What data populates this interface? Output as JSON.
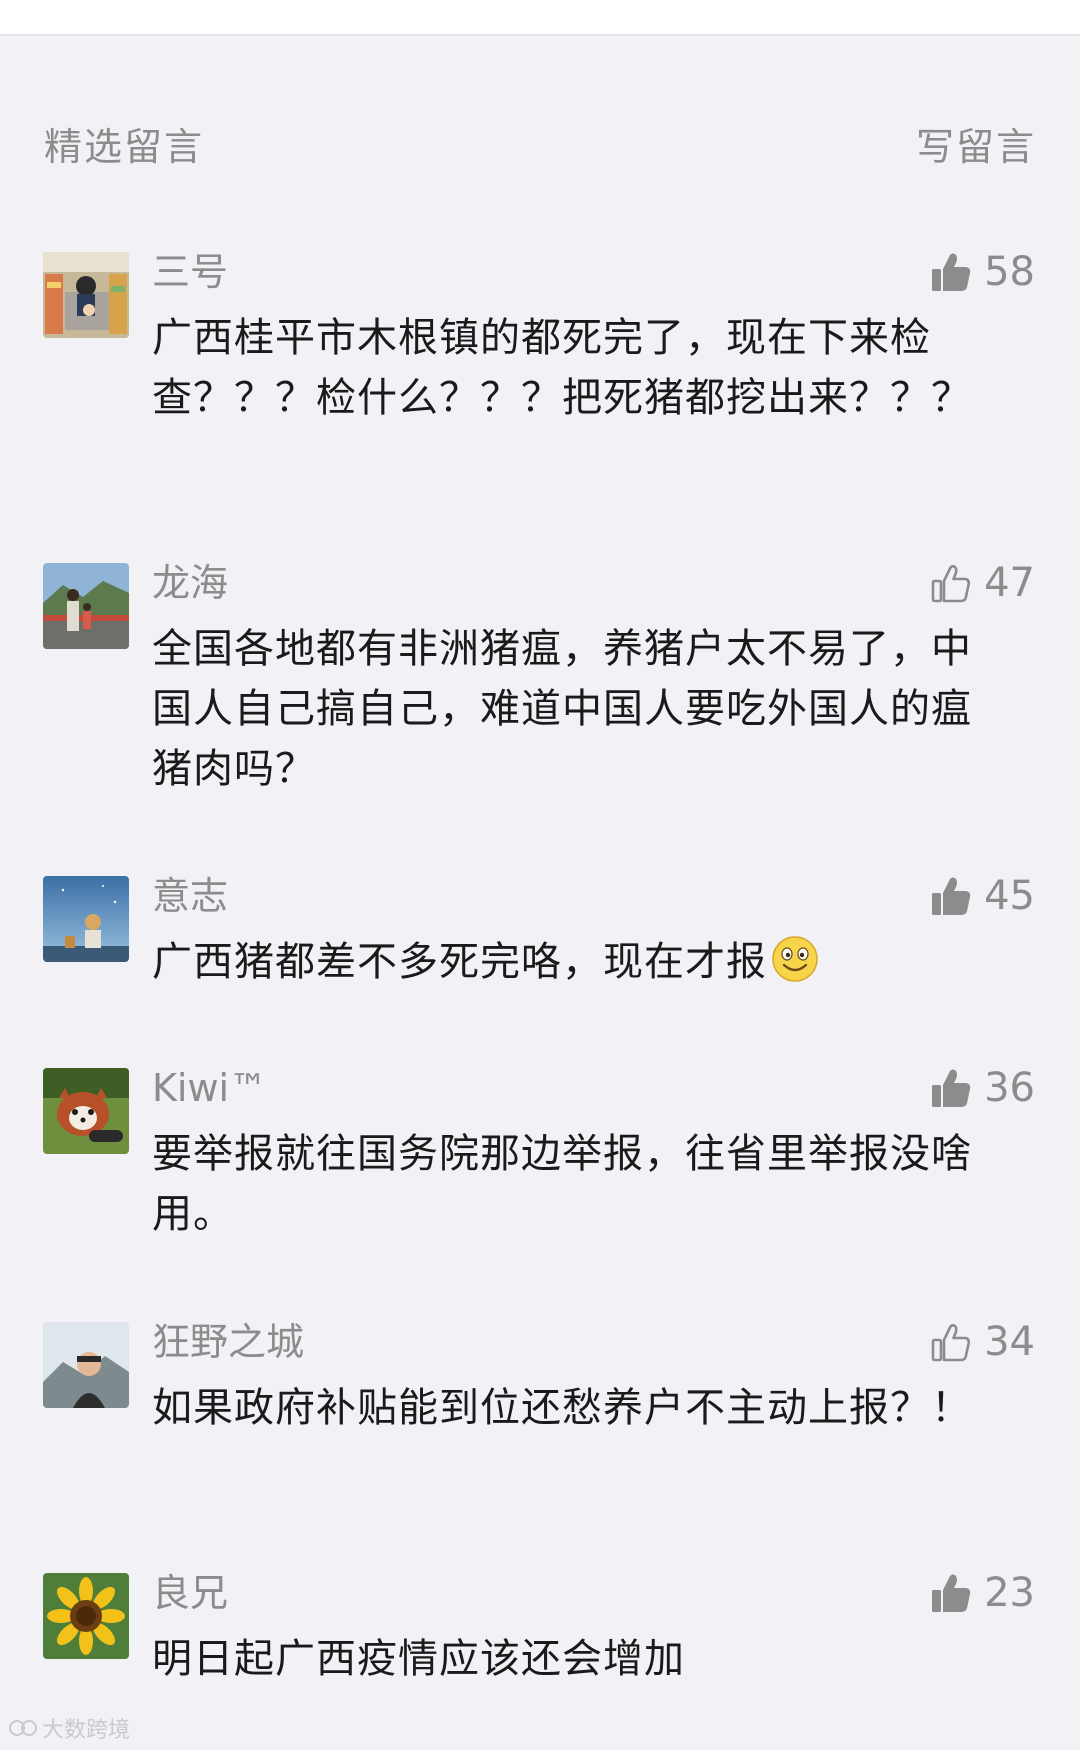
{
  "header": {
    "title": "精选留言",
    "write_label": "写留言"
  },
  "comments": [
    {
      "nickname": "三号",
      "likes": "58",
      "liked": true,
      "text": "广西桂平市木根镇的都死完了，现在下来检查？？？检什么？？？把死猪都挖出来？？？",
      "avatar": "supermarket-child-avatar"
    },
    {
      "nickname": "龙海",
      "likes": "47",
      "liked": false,
      "text": "全国各地都有非洲猪瘟，养猪户太不易了，中国人自己搞自己，难道中国人要吃外国人的瘟猪肉吗？",
      "avatar": "bridge-people-avatar"
    },
    {
      "nickname": "意志",
      "likes": "45",
      "liked": true,
      "text": "广西猪都差不多死完咯，现在才报",
      "emoji": "smiley-emoji",
      "avatar": "night-sky-child-avatar"
    },
    {
      "nickname": "Kiwi™",
      "likes": "36",
      "liked": true,
      "text": "要举报就往国务院那边举报，往省里举报没啥用。",
      "avatar": "red-panda-avatar"
    },
    {
      "nickname": "狂野之城",
      "likes": "34",
      "liked": false,
      "text": "如果政府补贴能到位还愁养户不主动上报？！",
      "avatar": "mountain-selfie-avatar"
    },
    {
      "nickname": "良兄",
      "likes": "23",
      "liked": true,
      "text": "明日起广西疫情应该还会增加",
      "avatar": "sunflower-avatar"
    }
  ],
  "watermark": {
    "text": "大数跨境"
  },
  "colors": {
    "background": "#f1f1f6",
    "secondary_text": "#8c8c8c",
    "body_text": "#1a1a1a",
    "like_icon": "#8c8c8c"
  }
}
